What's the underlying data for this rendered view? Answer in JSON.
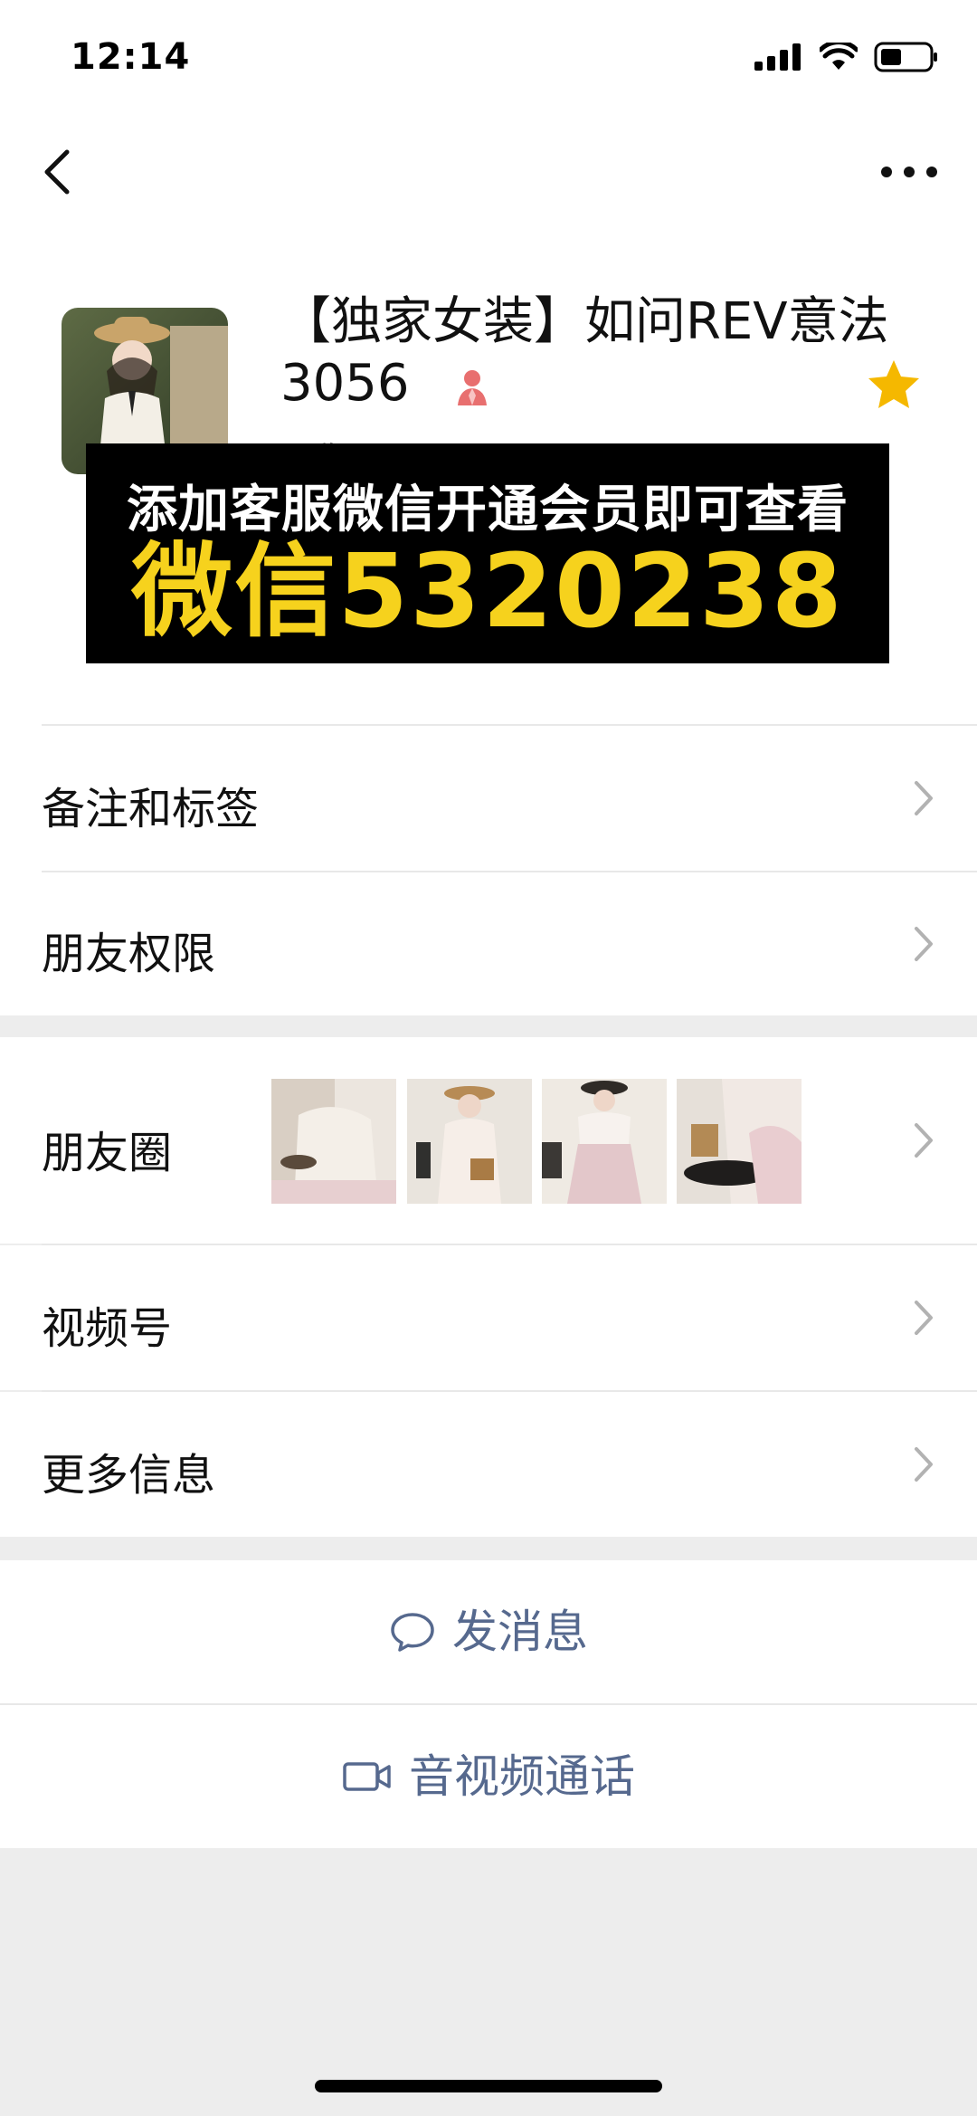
{
  "status_bar": {
    "time": "12:14"
  },
  "profile": {
    "name": "【独家女装】如问REV意法3056",
    "nickname_partial": "昵称",
    "star_color": "#f5b800",
    "gender_color": "#e86f6f"
  },
  "promo_banner": {
    "line1": "添加客服微信开通会员即可查看",
    "line2": "微信5320238",
    "bg_color": "#000000",
    "highlight_color": "#f6d21d"
  },
  "menu": {
    "remarks_tags": "备注和标签",
    "friend_permissions": "朋友权限",
    "moments": "朋友圈",
    "channels": "视频号",
    "more_info": "更多信息"
  },
  "actions": {
    "send_message": "发消息",
    "voice_video_call": "音视频通话",
    "accent_color": "#56698e"
  },
  "icons": {
    "back": "chevron-left-icon",
    "more": "more-dots-icon",
    "signal": "signal-icon",
    "wifi": "wifi-icon",
    "battery": "battery-icon",
    "gender": "female-icon",
    "star": "star-icon",
    "chat": "chat-bubble-icon",
    "video": "video-camera-icon"
  }
}
